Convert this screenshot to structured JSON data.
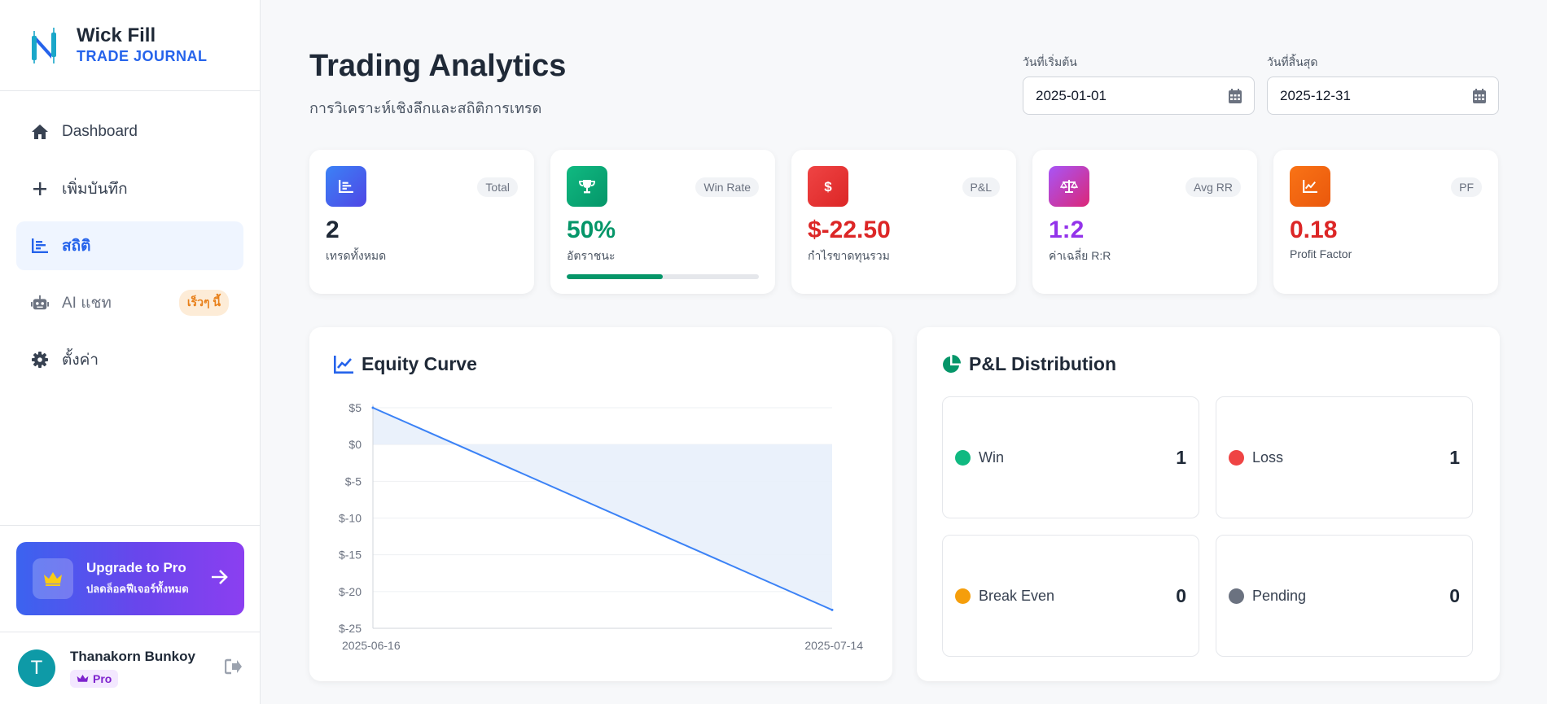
{
  "brand": {
    "name": "Wick Fill",
    "subtitle": "TRADE JOURNAL"
  },
  "nav": [
    {
      "label": "Dashboard",
      "icon": "home-icon",
      "active": false
    },
    {
      "label": "เพิ่มบันทึก",
      "icon": "plus-icon",
      "active": false
    },
    {
      "label": "สถิติ",
      "icon": "bar-chart-icon",
      "active": true
    },
    {
      "label": "AI แชท",
      "icon": "robot-icon",
      "active": false,
      "badge": "เร็วๆ นี้"
    },
    {
      "label": "ตั้งค่า",
      "icon": "gear-icon",
      "active": false
    }
  ],
  "upgrade": {
    "title": "Upgrade to Pro",
    "subtitle": "ปลดล็อคฟีเจอร์ทั้งหมด"
  },
  "user": {
    "initial": "T",
    "name": "Thanakorn Bunkoy",
    "plan": "Pro"
  },
  "page": {
    "title": "Trading Analytics",
    "subtitle": "การวิเคราะห์เชิงลึกและสถิติการเทรด"
  },
  "date_range": {
    "start_label": "วันที่เริ่มต้น",
    "start_value": "2025-01-01",
    "end_label": "วันที่สิ้นสุด",
    "end_value": "2025-12-31"
  },
  "stats": [
    {
      "tag": "Total",
      "value": "2",
      "label": "เทรดทั้งหมด",
      "icon": "bar-chart-icon",
      "color": "#1f2937"
    },
    {
      "tag": "Win Rate",
      "value": "50%",
      "label": "อัตราชนะ",
      "icon": "trophy-icon",
      "color": "#059669",
      "progress": 0.5
    },
    {
      "tag": "P&L",
      "value": "$-22.50",
      "label": "กำไรขาดทุนรวม",
      "icon": "dollar-icon",
      "color": "#dc2626"
    },
    {
      "tag": "Avg RR",
      "value": "1:2",
      "label": "ค่าเฉลี่ย R:R",
      "icon": "scale-icon",
      "color": "#9333ea"
    },
    {
      "tag": "PF",
      "value": "0.18",
      "label": "Profit Factor",
      "icon": "line-chart-icon",
      "color": "#dc2626"
    }
  ],
  "equity": {
    "title": "Equity Curve"
  },
  "chart_data": {
    "type": "line",
    "x": [
      "2025-06-16",
      "2025-07-14"
    ],
    "values": [
      5,
      -22.5
    ],
    "ylim": [
      -25,
      5
    ],
    "yticks": [
      "$5",
      "$0",
      "$-5",
      "$-10",
      "$-15",
      "$-20",
      "$-25"
    ],
    "ytick_values": [
      5,
      0,
      -5,
      -10,
      -15,
      -20,
      -25
    ],
    "xtick_labels": [
      "2025-06-16",
      "2025-07-14"
    ],
    "grid": true,
    "line_color": "#3b82f6",
    "fill_color": "#e8effb"
  },
  "distribution": {
    "title": "P&L Distribution",
    "items": [
      {
        "label": "Win",
        "value": "1",
        "color": "#10b981"
      },
      {
        "label": "Loss",
        "value": "1",
        "color": "#ef4444"
      },
      {
        "label": "Break Even",
        "value": "0",
        "color": "#f59e0b"
      },
      {
        "label": "Pending",
        "value": "0",
        "color": "#6b7280"
      }
    ]
  }
}
